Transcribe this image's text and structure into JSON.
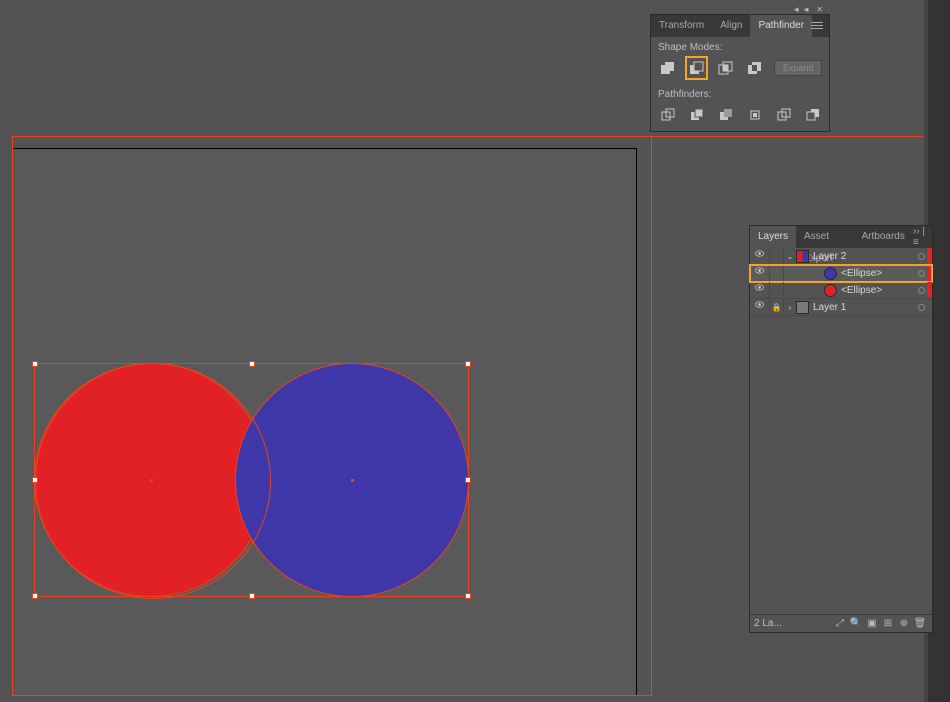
{
  "pathfinder": {
    "tabs": {
      "transform": "Transform",
      "align": "Align",
      "pathfinder": "Pathfinder"
    },
    "shape_modes_label": "Shape Modes:",
    "pathfinders_label": "Pathfinders:",
    "expand_label": "Expand"
  },
  "layers": {
    "tabs": {
      "layers": "Layers",
      "asset_export": "Asset Export",
      "artboards": "Artboards"
    },
    "rows": [
      {
        "name": "Layer 2"
      },
      {
        "name": "<Ellipse>"
      },
      {
        "name": "<Ellipse>"
      },
      {
        "name": "Layer 1"
      }
    ],
    "footer_count": "2 La..."
  },
  "colors": {
    "red": "#e22126",
    "blue": "#3f36a7",
    "highlight": "#f2a427"
  }
}
